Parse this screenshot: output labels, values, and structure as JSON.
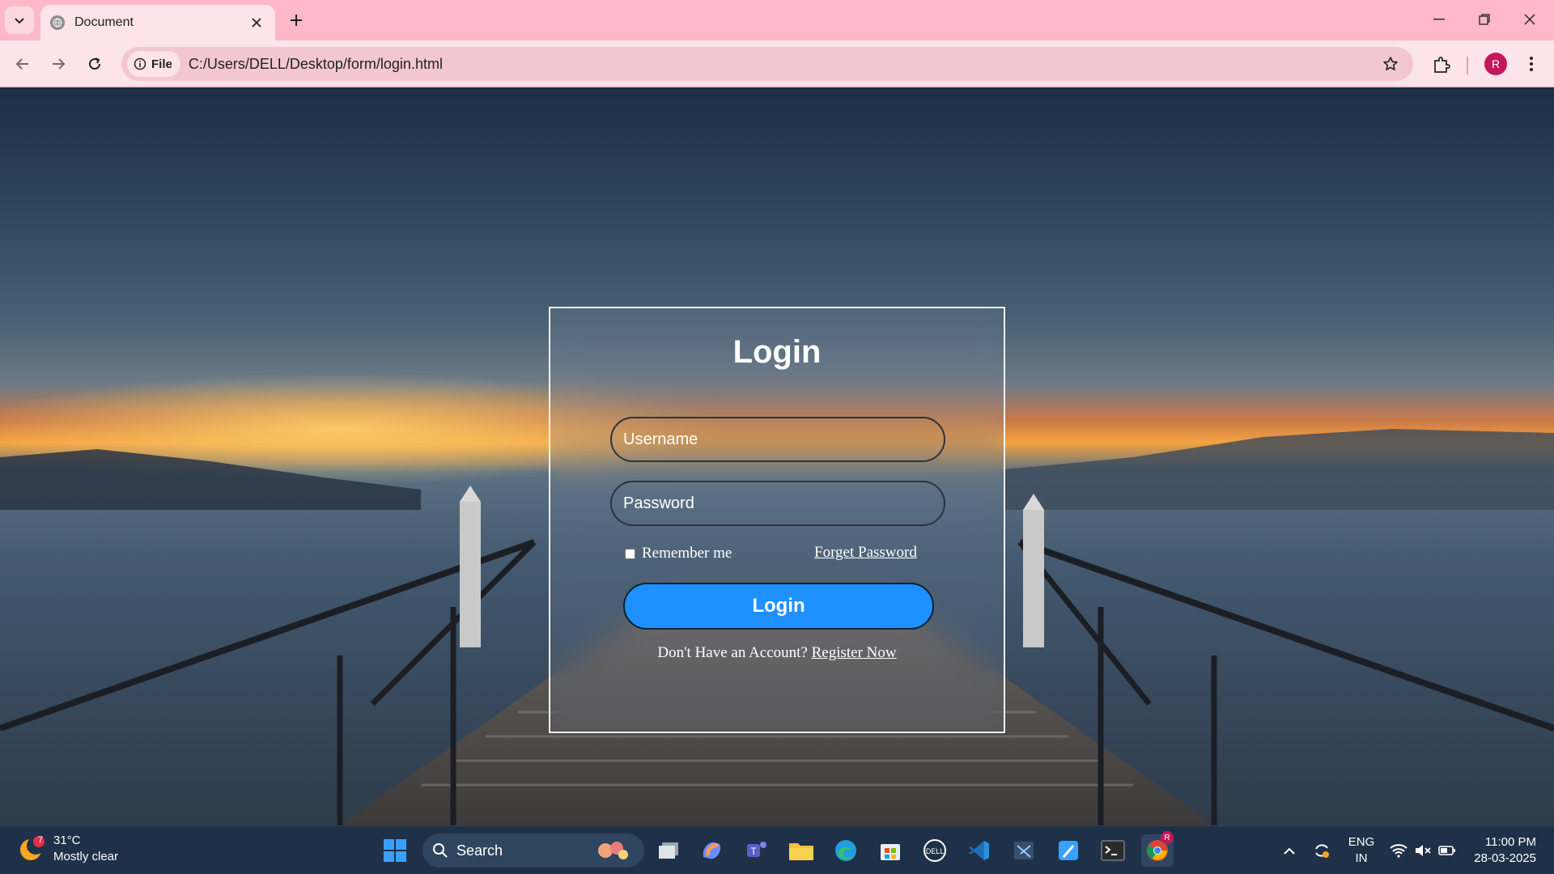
{
  "browser": {
    "tab_title": "Document",
    "address_chip": "File",
    "url": "C:/Users/DELL/Desktop/form/login.html",
    "profile_initial": "R",
    "theme_color": "#ffb8c8"
  },
  "login": {
    "title": "Login",
    "username_placeholder": "Username",
    "password_placeholder": "Password",
    "remember_label": "Remember me",
    "forget_label": "Forget Password",
    "button_label": "Login",
    "register_prompt": "Don't Have an Account?",
    "register_link": "Register Now",
    "button_color": "#1e90ff"
  },
  "taskbar": {
    "weather_badge": "7",
    "temperature": "31°C",
    "weather_desc": "Mostly clear",
    "search_label": "Search",
    "lang_line1": "ENG",
    "lang_line2": "IN",
    "time": "11:00 PM",
    "date": "28-03-2025",
    "chrome_badge": "R",
    "apps": [
      "windows-start",
      "search",
      "task-view",
      "copilot",
      "teams",
      "file-explorer",
      "edge",
      "microsoft-store",
      "dell",
      "vscode",
      "snipping-tool",
      "paint",
      "terminal",
      "chrome"
    ]
  }
}
